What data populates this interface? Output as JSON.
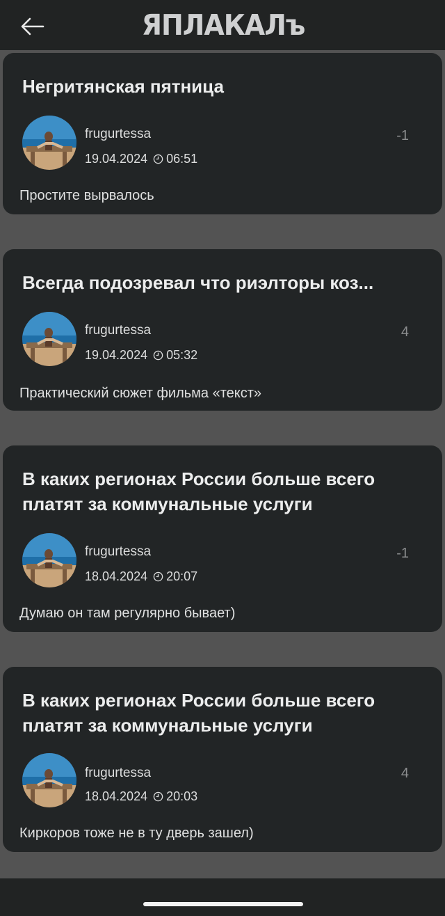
{
  "header": {
    "logo_text": "ЯПЛАКАЛъ",
    "back_icon": "arrow-left-icon"
  },
  "comments": [
    {
      "title": "Негритянская пятница",
      "author": "frugurtessa",
      "date": "19.04.2024",
      "time": "06:51",
      "rating": "-1",
      "text": "Простите вырвалось"
    },
    {
      "title": "Всегда подозревал что риэлторы коз...",
      "author": "frugurtessa",
      "date": "19.04.2024",
      "time": "05:32",
      "rating": "4",
      "text": "Практический сюжет фильма «текст»"
    },
    {
      "title": "В каких регионах России больше всего платят за коммунальные услуги",
      "author": "frugurtessa",
      "date": "18.04.2024",
      "time": "20:07",
      "rating": "-1",
      "text": "Думаю он там регулярно бывает)"
    },
    {
      "title": "В каких регионах России больше всего платят за коммунальные услуги",
      "author": "frugurtessa",
      "date": "18.04.2024",
      "time": "20:03",
      "rating": "4",
      "text": "Киркоров тоже не в ту дверь зашел)"
    }
  ],
  "colors": {
    "background": "#535353",
    "card": "#222526",
    "bar": "#212323",
    "text": "#eceded",
    "muted": "#8b8d8e"
  }
}
